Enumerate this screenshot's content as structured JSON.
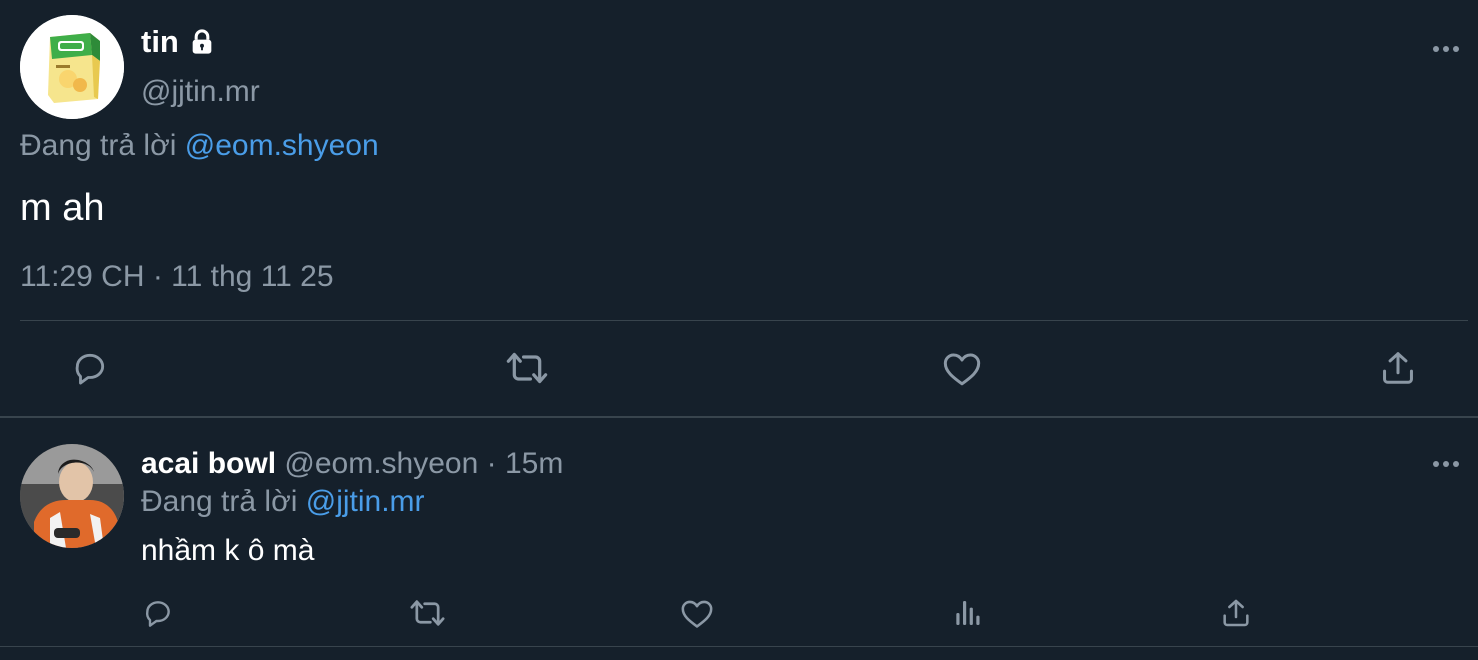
{
  "main_tweet": {
    "display_name": "tin",
    "handle": "@jjtin.mr",
    "reply_prefix": "Đang trả lời",
    "reply_to": "@eom.shyeon",
    "text": "m ah",
    "timestamp": "11:29 CH · 11 thg 11 25",
    "icons": [
      "lock-icon",
      "more-icon",
      "reply-icon",
      "retweet-icon",
      "like-icon",
      "share-icon"
    ]
  },
  "reply_tweet": {
    "display_name": "acai bowl",
    "handle": "@eom.shyeon",
    "separator": " · ",
    "time": "15m",
    "reply_prefix": "Đang trả lời",
    "reply_to": "@jjtin.mr",
    "text": "nhầm k ô mà",
    "icons": [
      "more-icon",
      "reply-icon",
      "retweet-icon",
      "like-icon",
      "analytics-icon",
      "share-icon"
    ]
  },
  "colors": {
    "background": "#15202b",
    "primary_text": "#ffffff",
    "secondary_text": "#8b98a5",
    "link": "#4a9de8",
    "divider": "#38444d"
  }
}
